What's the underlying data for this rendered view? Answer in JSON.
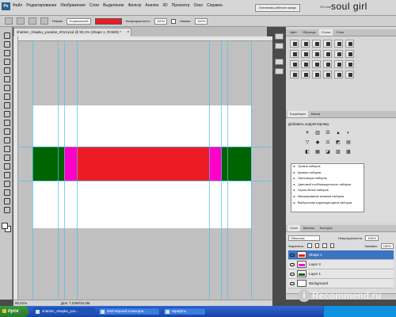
{
  "app": {
    "logo": "Ps",
    "menu": [
      "Файл",
      "Редактирование",
      "Изображение",
      "Слои",
      "Выделение",
      "Фильтр",
      "Анализ",
      "3D",
      "Просмотр",
      "Окно",
      "Справка"
    ],
    "zoom_readout": "50,1",
    "workspace_button": "Основная рабочая среда",
    "cs_live": "CS Live",
    "user_watermark": "soul girl"
  },
  "options_bar": {
    "mode_label": "Режим:",
    "mode_value": "Нормальный",
    "opacity_label": "Непрозрачность:",
    "opacity_value": "100%",
    "fill_label": "Нажим:",
    "fill_value": "100%",
    "style_color": "#ed1c24"
  },
  "document": {
    "tab_title": "shablon_shapka_youtube_2013.psd @ 50,1% (Shape 1, RGB/8) *",
    "zoom": "50,01%",
    "doc_info": "Док: 7,03M/15,0M"
  },
  "artwork": {
    "background": "#ffffff",
    "band_green": "#006400",
    "band_magenta": "#ff00c8",
    "band_red": "#ed1c24"
  },
  "panels": {
    "top_tabs": [
      "Цвет",
      "Образцы",
      "Стили",
      "Слои"
    ],
    "adjust_tabs": [
      "Коррекция",
      "Маски"
    ],
    "adjust_title": "Добавить корректировку",
    "adjust_icons_row1": [
      "☀",
      "▥",
      "☒",
      "▲",
      "◐"
    ],
    "adjust_icons_row2": [
      "▽",
      "◆",
      "⚖",
      "◩",
      "▤"
    ],
    "adjust_icons_row3": [
      "◧",
      "▦",
      "◪",
      "▨",
      "▩"
    ],
    "presets": [
      "Уровни наборов",
      "Кривые наборов",
      "Экспозиция наборов",
      "Цветовой тон/Насыщенность наборов",
      "Черно-белое наборов",
      "Микширование каналов наборов",
      "Выборочная коррекция цвета наборов"
    ],
    "layers_tabs": [
      "Слои",
      "Каналы",
      "Контуры"
    ],
    "blend_mode": "Обычные",
    "opacity_label": "Непрозрачность:",
    "opacity_value": "100%",
    "lock_label": "Закрепить:",
    "fill_label": "Заливка:",
    "fill_value": "100%",
    "layers": [
      {
        "name": "Shape 1",
        "thumb": "#ed1c24"
      },
      {
        "name": "Layer 2",
        "thumb": "#ff00c8"
      },
      {
        "name": "Layer 1",
        "thumb": "#006400"
      },
      {
        "name": "Background",
        "thumb": "#ffffff"
      }
    ]
  },
  "taskbar": {
    "start": "пуск",
    "tasks": [
      "shablon_shapka_you...",
      "Мой верный помощни...",
      "Шрифты"
    ]
  },
  "watermark": {
    "logo": "i",
    "text": "Recommend.ru"
  }
}
